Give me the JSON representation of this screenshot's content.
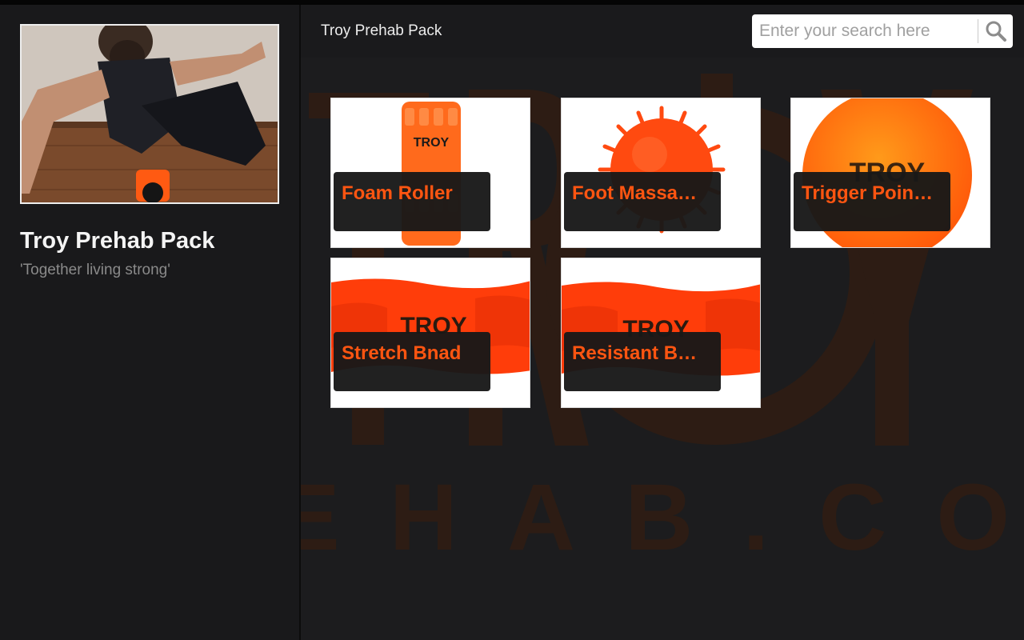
{
  "sidebar": {
    "title": "Troy Prehab Pack",
    "tagline": "'Together living strong'"
  },
  "header": {
    "title": "Troy Prehab Pack"
  },
  "search": {
    "placeholder": "Enter your search here",
    "icon": "search-icon"
  },
  "watermark": {
    "text": "EHAB.COM",
    "logo": "TROY"
  },
  "products": [
    {
      "label": "Foam Roller"
    },
    {
      "label": "Foot Massa…"
    },
    {
      "label": "Trigger Poin…"
    },
    {
      "label": "Stretch Bnad"
    },
    {
      "label": "Resistant B…"
    }
  ],
  "colors": {
    "accent": "#ff5511",
    "background": "#1c1c1e",
    "watermark": "#2d1c14"
  }
}
